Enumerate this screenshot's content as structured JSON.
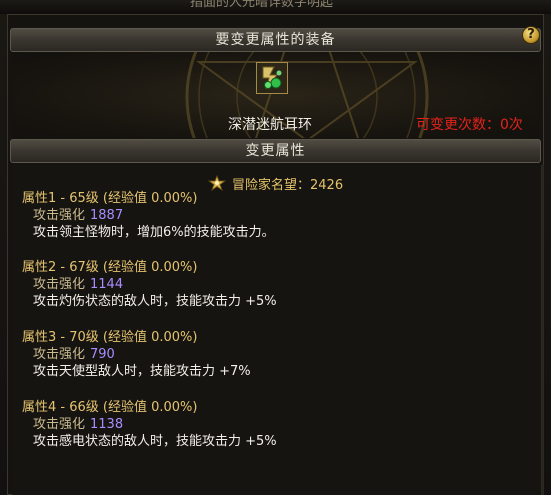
{
  "header_top_cut_text": "指面的人光暗详数字明起",
  "equip_section": {
    "title": "要变更属性的装备",
    "help_label": "?",
    "item_name": "深潜迷航耳环",
    "change_count_text": "可变更次数：0次"
  },
  "change_section": {
    "title": "变更属性",
    "fame_text": "冒险家名望：2426"
  },
  "attributes": [
    {
      "title": "属性1 - 65级 (经验值 0.00%)",
      "stat_label": "攻击强化",
      "stat_value": "1887",
      "desc": "攻击领主怪物时，增加6%的技能攻击力。"
    },
    {
      "title": "属性2 - 67级 (经验值 0.00%)",
      "stat_label": "攻击强化",
      "stat_value": "1144",
      "desc": "攻击灼伤状态的敌人时，技能攻击力 +5%"
    },
    {
      "title": "属性3 - 70级 (经验值 0.00%)",
      "stat_label": "攻击强化",
      "stat_value": "790",
      "desc": "攻击天使型敌人时，技能攻击力 +7%"
    },
    {
      "title": "属性4 - 66级 (经验值 0.00%)",
      "stat_label": "攻击强化",
      "stat_value": "1138",
      "desc": "攻击感电状态的敌人时，技能攻击力 +5%"
    }
  ],
  "colors": {
    "attr_title": "#e5c470",
    "stat_value": "#a98cff",
    "warning": "#e2231a"
  },
  "icons": {
    "help": "question-mark-icon",
    "fame": "fame-crest-icon",
    "item": "earring-item-icon"
  }
}
